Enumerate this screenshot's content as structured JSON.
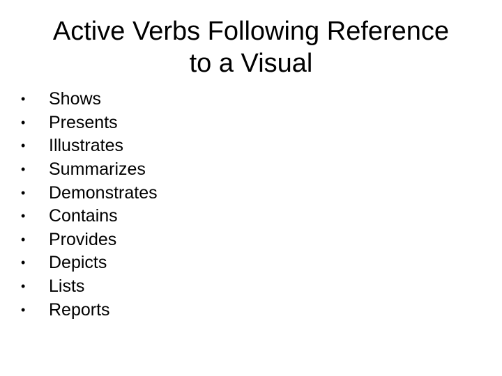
{
  "slide": {
    "title_line1": "Active Verbs Following Reference",
    "title_line2": "to a Visual",
    "bullet_glyph": "•",
    "bullets": [
      "Shows",
      "Presents",
      "Illustrates",
      "Summarizes",
      "Demonstrates",
      "Contains",
      "Provides",
      "Depicts",
      "Lists",
      "Reports"
    ]
  }
}
